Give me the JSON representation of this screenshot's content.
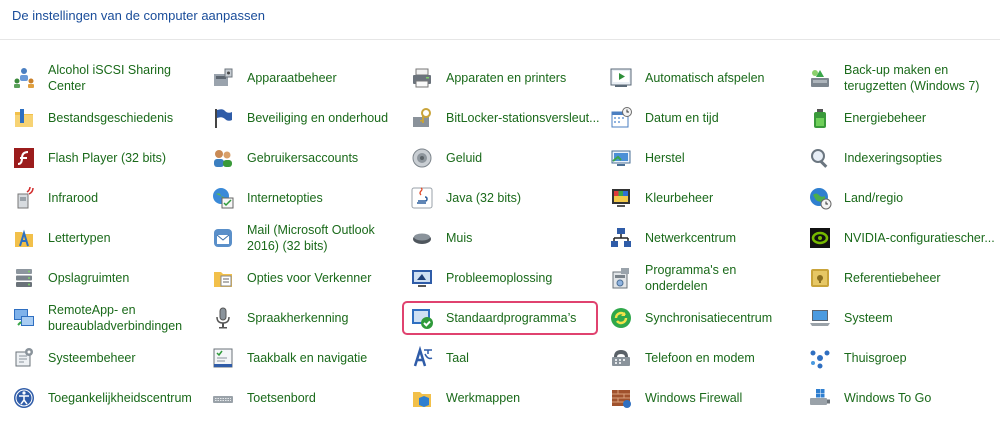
{
  "header": {
    "title": "De instellingen van de computer aanpassen"
  },
  "items": [
    {
      "label": "Alcohol iSCSI Sharing Center",
      "icon": "network-users-icon"
    },
    {
      "label": "Apparaatbeheer",
      "icon": "device-manager-icon"
    },
    {
      "label": "Apparaten en printers",
      "icon": "printer-icon"
    },
    {
      "label": "Automatisch afspelen",
      "icon": "autoplay-icon"
    },
    {
      "label": "Back-up maken en terugzetten (Windows 7)",
      "icon": "backup-icon"
    },
    {
      "label": "Bestandsgeschiedenis",
      "icon": "file-history-icon"
    },
    {
      "label": "Beveiliging en onderhoud",
      "icon": "flag-icon"
    },
    {
      "label": "BitLocker-stationsversleut...",
      "icon": "bitlocker-key-icon"
    },
    {
      "label": "Datum en tijd",
      "icon": "calendar-clock-icon"
    },
    {
      "label": "Energiebeheer",
      "icon": "battery-icon"
    },
    {
      "label": "Flash Player (32 bits)",
      "icon": "flash-icon"
    },
    {
      "label": "Gebruikersaccounts",
      "icon": "users-icon"
    },
    {
      "label": "Geluid",
      "icon": "speaker-icon"
    },
    {
      "label": "Herstel",
      "icon": "recovery-icon"
    },
    {
      "label": "Indexeringsopties",
      "icon": "magnifier-icon"
    },
    {
      "label": "Infrarood",
      "icon": "infrared-icon"
    },
    {
      "label": "Internetopties",
      "icon": "internet-options-icon"
    },
    {
      "label": "Java (32 bits)",
      "icon": "java-icon"
    },
    {
      "label": "Kleurbeheer",
      "icon": "color-management-icon"
    },
    {
      "label": "Land/regio",
      "icon": "globe-clock-icon"
    },
    {
      "label": "Lettertypen",
      "icon": "fonts-folder-icon"
    },
    {
      "label": "Mail (Microsoft Outlook 2016) (32 bits)",
      "icon": "mail-icon"
    },
    {
      "label": "Muis",
      "icon": "mouse-icon"
    },
    {
      "label": "Netwerkcentrum",
      "icon": "network-center-icon"
    },
    {
      "label": "NVIDIA-configuratiescher...",
      "icon": "nvidia-icon"
    },
    {
      "label": "Opslagruimten",
      "icon": "storage-spaces-icon"
    },
    {
      "label": "Opties voor Verkenner",
      "icon": "folder-options-icon"
    },
    {
      "label": "Probleemoplossing",
      "icon": "troubleshoot-icon"
    },
    {
      "label": "Programma's en onderdelen",
      "icon": "programs-icon"
    },
    {
      "label": "Referentiebeheer",
      "icon": "credential-vault-icon"
    },
    {
      "label": "RemoteApp- en bureaubladverbindingen",
      "icon": "remote-desktop-icon"
    },
    {
      "label": "Spraakherkenning",
      "icon": "microphone-icon"
    },
    {
      "label": "Standaardprogramma’s",
      "icon": "default-programs-icon"
    },
    {
      "label": "Synchronisatiecentrum",
      "icon": "sync-icon"
    },
    {
      "label": "Systeem",
      "icon": "laptop-icon"
    },
    {
      "label": "Systeembeheer",
      "icon": "admin-tools-icon"
    },
    {
      "label": "Taakbalk en navigatie",
      "icon": "taskbar-icon"
    },
    {
      "label": "Taal",
      "icon": "language-icon"
    },
    {
      "label": "Telefoon en modem",
      "icon": "phone-modem-icon"
    },
    {
      "label": "Thuisgroep",
      "icon": "homegroup-icon"
    },
    {
      "label": "Toegankelijkheidscentrum",
      "icon": "accessibility-icon"
    },
    {
      "label": "Toetsenbord",
      "icon": "keyboard-icon"
    },
    {
      "label": "Werkmappen",
      "icon": "work-folders-icon"
    },
    {
      "label": "Windows Firewall",
      "icon": "firewall-icon"
    },
    {
      "label": "Windows To Go",
      "icon": "windows-to-go-icon"
    }
  ],
  "highlighted_item": "Standaardprogramma’s"
}
